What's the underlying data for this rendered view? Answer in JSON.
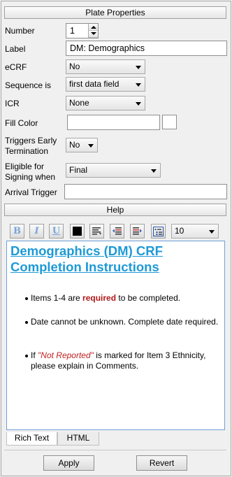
{
  "plate_properties": {
    "header": "Plate Properties",
    "number": {
      "label": "Number",
      "value": "1"
    },
    "label_field": {
      "label": "Label",
      "value": "DM: Demographics"
    },
    "ecrf": {
      "label": "eCRF",
      "value": "No"
    },
    "sequence": {
      "label": "Sequence is",
      "value": "first data field"
    },
    "icr": {
      "label": "ICR",
      "value": "None"
    },
    "fill_color": {
      "label": "Fill Color",
      "value": ""
    },
    "triggers_early_termination": {
      "label_line1": "Triggers Early",
      "label_line2": "Termination",
      "value": "No"
    },
    "eligible_for_signing": {
      "label_line1": "Eligible for",
      "label_line2": "Signing when",
      "value": "Final"
    },
    "arrival_trigger": {
      "label": "Arrival Trigger",
      "value": ""
    }
  },
  "help": {
    "header": "Help",
    "toolbar": {
      "bold_icon": "B",
      "italic_icon": "I",
      "underline_icon": "U",
      "font_size": "10"
    },
    "document": {
      "title": "Demographics (DM) CRF Completion Instructions",
      "bullet1": {
        "pre": "Items 1-4 are ",
        "emph": "required",
        "post": " to be completed."
      },
      "bullet2": "Date cannot be unknown. Complete date required.",
      "bullet3": {
        "pre": "If ",
        "emph": "\"Not Reported\"",
        "post": " is marked for Item 3 Ethnicity, please explain in Comments."
      }
    },
    "tabs": [
      "Rich Text",
      "HTML"
    ]
  },
  "actions": {
    "apply": "Apply",
    "revert": "Revert"
  },
  "colors": {
    "title_blue": "#1e9ad6",
    "required_red": "#b01818",
    "editor_border": "#6fa0d8"
  }
}
